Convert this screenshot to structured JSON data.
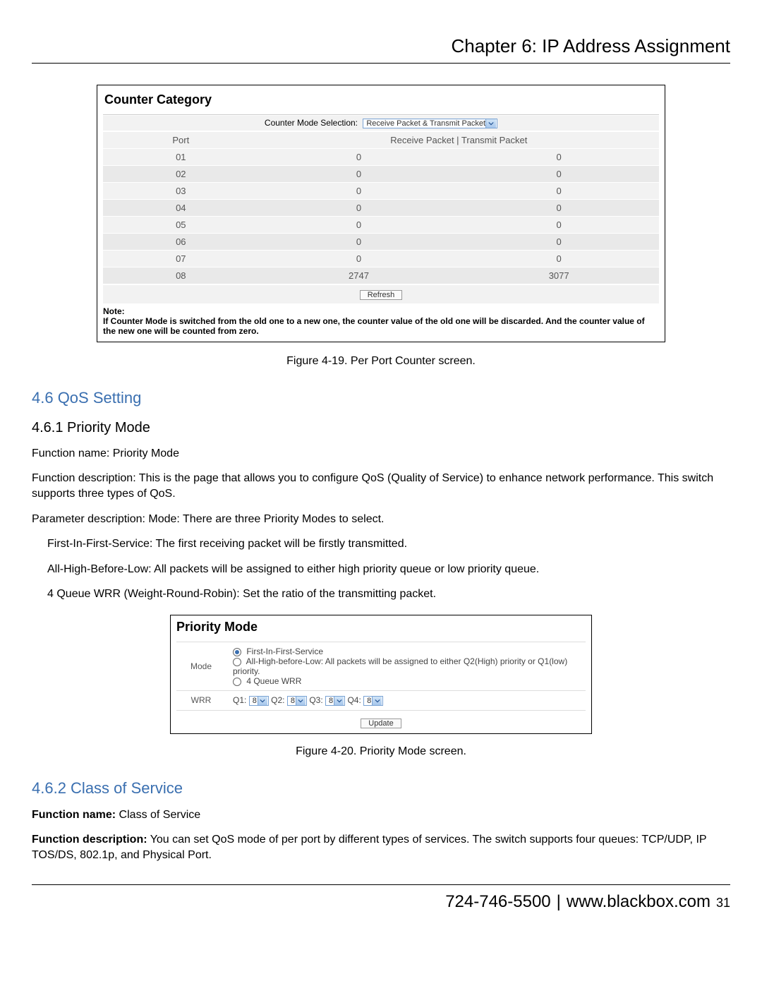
{
  "header": {
    "title": "Chapter 6: IP Address Assignment"
  },
  "counterCategory": {
    "panel_title": "Counter Category",
    "selection_label": "Counter Mode Selection:",
    "selection_value": "Receive Packet & Transmit Packet",
    "columns": {
      "port": "Port",
      "metric": "Receive Packet | Transmit Packet"
    },
    "rows": [
      {
        "port": "01",
        "rx": "0",
        "tx": "0"
      },
      {
        "port": "02",
        "rx": "0",
        "tx": "0"
      },
      {
        "port": "03",
        "rx": "0",
        "tx": "0"
      },
      {
        "port": "04",
        "rx": "0",
        "tx": "0"
      },
      {
        "port": "05",
        "rx": "0",
        "tx": "0"
      },
      {
        "port": "06",
        "rx": "0",
        "tx": "0"
      },
      {
        "port": "07",
        "rx": "0",
        "tx": "0"
      },
      {
        "port": "08",
        "rx": "2747",
        "tx": "3077"
      }
    ],
    "refresh_label": "Refresh",
    "note_head": "Note:",
    "note_body": "If Counter Mode is switched from the old one to a new one, the counter value of the old one will be discarded. And the counter value of the new one will be counted from zero."
  },
  "fig419": "Figure 4-19. Per Port Counter screen.",
  "sections": {
    "qos_heading": "4.6 QoS Setting",
    "priority_heading": "4.6.1 Priority Mode",
    "func_name_line": "Function name:  Priority Mode",
    "func_desc": "Function description: This is the page that allows you to configure QoS (Quality of Service) to enhance network performance. This switch supports three types of QoS.",
    "param_desc": "Parameter description: Mode: There are three Priority Modes to select.",
    "first_in": "First-In-First-Service: The first receiving packet will be firstly transmitted.",
    "all_high": "All-High-Before-Low: All packets will be assigned to either high priority queue or low priority queue.",
    "wrr_desc": "4 Queue WRR (Weight-Round-Robin): Set the ratio of the transmitting packet."
  },
  "priorityMode": {
    "panel_title": "Priority Mode",
    "mode_label": "Mode",
    "opt_first": "First-In-First-Service",
    "opt_allhigh": "All-High-before-Low: All packets will be assigned to either Q2(High) priority or Q1(low) priority.",
    "opt_wrr4": "4 Queue WRR",
    "wrr_label": "WRR",
    "q1_label": "Q1:",
    "q2_label": "Q2:",
    "q3_label": "Q3:",
    "q4_label": "Q4:",
    "q_value": "8",
    "update_label": "Update"
  },
  "fig420": "Figure 4-20. Priority Mode screen.",
  "cos": {
    "heading": "4.6.2 Class of Service",
    "func_name_bold": "Function name:",
    "func_name_val": " Class of Service",
    "func_desc_bold": "Function description:",
    "func_desc_val": " You can set QoS mode of per port by different types of services. The switch supports four queues: TCP/UDP, IP TOS/DS, 802.1p, and Physical Port."
  },
  "footer": {
    "phone": "724-746-5500",
    "sep": "|",
    "url": "www.blackbox.com",
    "page_no": "31"
  }
}
